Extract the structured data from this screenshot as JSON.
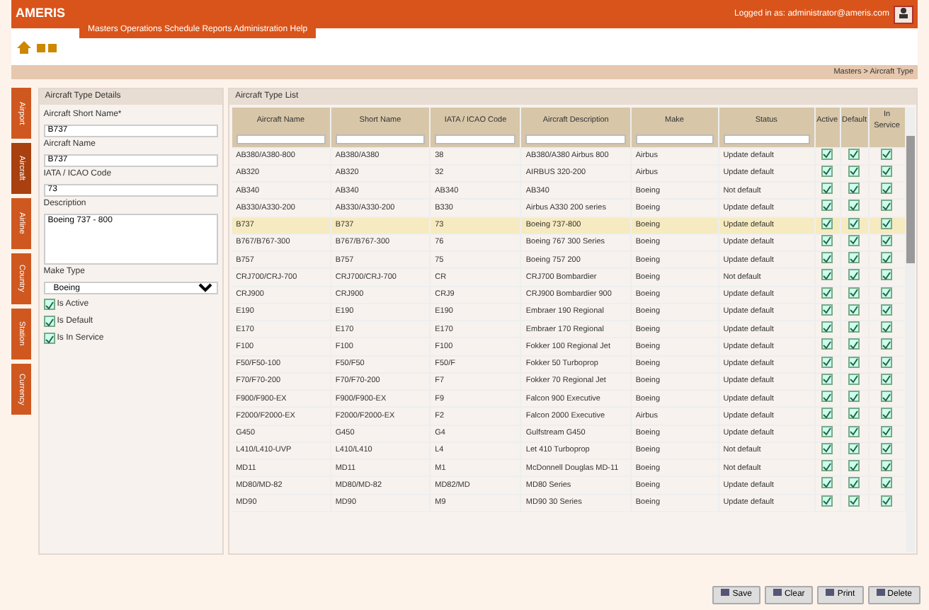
{
  "header": {
    "logo": "AMERIS",
    "user": "Logged in as: administrator@ameris.com"
  },
  "nav": {
    "menu": "Masters  Operations  Schedule  Reports  Administration  Help"
  },
  "breadcrumb": "Masters > Aircraft Type",
  "side_tabs": [
    {
      "label": "Airport",
      "selected": false
    },
    {
      "label": "Aircraft",
      "selected": true
    },
    {
      "label": "Airline",
      "selected": false
    },
    {
      "label": "Country",
      "selected": false
    },
    {
      "label": "Station",
      "selected": false
    },
    {
      "label": "Currency",
      "selected": false
    }
  ],
  "form": {
    "title": "Aircraft Type Details",
    "fields": [
      {
        "label": "Aircraft Short Name*",
        "value": "B737"
      },
      {
        "label": "Aircraft Name",
        "value": "B737"
      },
      {
        "label": "IATA / ICAO Code",
        "value": "73"
      }
    ],
    "description": {
      "label": "Description",
      "value": "Boeing 737 - 800"
    },
    "make": {
      "label": "Make Type",
      "value": "Boeing"
    },
    "checks": [
      {
        "label": "Is Active",
        "checked": true
      },
      {
        "label": "Is Default",
        "checked": true
      },
      {
        "label": "Is In Service",
        "checked": true
      }
    ]
  },
  "table": {
    "title": "Aircraft Type List",
    "columns": [
      "Aircraft Name",
      "Short Name",
      "IATA / ICAO Code",
      "Aircraft Description",
      "Make",
      "Status",
      "Active",
      "Default",
      "In Service"
    ],
    "rows": [
      {
        "cells": [
          "AB380/A380-800",
          "AB380/A380",
          "38",
          "AB380/A380 Airbus 800",
          "Airbus",
          "Update default"
        ],
        "checks": [
          true,
          true,
          true
        ],
        "selected": false
      },
      {
        "cells": [
          "AB320",
          "AB320",
          "32",
          "AIRBUS 320-200",
          "Airbus",
          "Update default"
        ],
        "checks": [
          true,
          true,
          true
        ],
        "selected": false
      },
      {
        "cells": [
          "AB340",
          "AB340",
          "AB340",
          "AB340",
          "Boeing",
          "Not default"
        ],
        "checks": [
          true,
          true,
          true
        ],
        "selected": false
      },
      {
        "cells": [
          "AB330/A330-200",
          "AB330/A330-200",
          "B330",
          "Airbus A330 200 series",
          "Boeing",
          "Update default"
        ],
        "checks": [
          true,
          true,
          true
        ],
        "selected": false
      },
      {
        "cells": [
          "B737",
          "B737",
          "73",
          "Boeing 737-800",
          "Boeing",
          "Update default"
        ],
        "checks": [
          true,
          true,
          true
        ],
        "selected": true
      },
      {
        "cells": [
          "B767/B767-300",
          "B767/B767-300",
          "76",
          "Boeing 767 300 Series",
          "Boeing",
          "Update default"
        ],
        "checks": [
          true,
          true,
          true
        ],
        "selected": false
      },
      {
        "cells": [
          "B757",
          "B757",
          "75",
          "Boeing 757 200",
          "Boeing",
          "Update default"
        ],
        "checks": [
          true,
          true,
          true
        ],
        "selected": false
      },
      {
        "cells": [
          "CRJ700/CRJ-700",
          "CRJ700/CRJ-700",
          "CR",
          "CRJ700 Bombardier",
          "Boeing",
          "Not default"
        ],
        "checks": [
          true,
          true,
          true
        ],
        "selected": false
      },
      {
        "cells": [
          "CRJ900",
          "CRJ900",
          "CRJ9",
          "CRJ900 Bombardier 900",
          "Boeing",
          "Update default"
        ],
        "checks": [
          true,
          true,
          true
        ],
        "selected": false
      },
      {
        "cells": [
          "E190",
          "E190",
          "E190",
          "Embraer 190 Regional",
          "Boeing",
          "Update default"
        ],
        "checks": [
          true,
          true,
          true
        ],
        "selected": false
      },
      {
        "cells": [
          "E170",
          "E170",
          "E170",
          "Embraer 170 Regional",
          "Boeing",
          "Update default"
        ],
        "checks": [
          true,
          true,
          true
        ],
        "selected": false
      },
      {
        "cells": [
          "F100",
          "F100",
          "F100",
          "Fokker 100 Regional Jet",
          "Boeing",
          "Update default"
        ],
        "checks": [
          true,
          true,
          true
        ],
        "selected": false
      },
      {
        "cells": [
          "F50/F50-100",
          "F50/F50",
          "F50/F",
          "Fokker 50 Turboprop",
          "Boeing",
          "Update default"
        ],
        "checks": [
          true,
          true,
          true
        ],
        "selected": false
      },
      {
        "cells": [
          "F70/F70-200",
          "F70/F70-200",
          "F7",
          "Fokker 70 Regional Jet",
          "Boeing",
          "Update default"
        ],
        "checks": [
          true,
          true,
          true
        ],
        "selected": false
      },
      {
        "cells": [
          "F900/F900-EX",
          "F900/F900-EX",
          "F9",
          "Falcon 900 Executive",
          "Boeing",
          "Update default"
        ],
        "checks": [
          true,
          true,
          true
        ],
        "selected": false
      },
      {
        "cells": [
          "F2000/F2000-EX",
          "F2000/F2000-EX",
          "F2",
          "Falcon 2000 Executive",
          "Airbus",
          "Update default"
        ],
        "checks": [
          true,
          true,
          true
        ],
        "selected": false
      },
      {
        "cells": [
          "G450",
          "G450",
          "G4",
          "Gulfstream G450",
          "Boeing",
          "Update default"
        ],
        "checks": [
          true,
          true,
          true
        ],
        "selected": false
      },
      {
        "cells": [
          "L410/L410-UVP",
          "L410/L410",
          "L4",
          "Let 410 Turboprop",
          "Boeing",
          "Not default"
        ],
        "checks": [
          true,
          true,
          true
        ],
        "selected": false
      },
      {
        "cells": [
          "MD11",
          "MD11",
          "M1",
          "McDonnell Douglas MD-11",
          "Boeing",
          "Not default"
        ],
        "checks": [
          true,
          true,
          true
        ],
        "selected": false
      },
      {
        "cells": [
          "MD80/MD-82",
          "MD80/MD-82",
          "MD82/MD",
          "MD80 Series",
          "Boeing",
          "Update default"
        ],
        "checks": [
          true,
          true,
          true
        ],
        "selected": false
      },
      {
        "cells": [
          "MD90",
          "MD90",
          "M9",
          "MD90 30 Series",
          "Boeing",
          "Update default"
        ],
        "checks": [
          true,
          true,
          true
        ],
        "selected": false
      }
    ]
  },
  "buttons": [
    "Save",
    "Clear",
    "Print",
    "Delete"
  ]
}
